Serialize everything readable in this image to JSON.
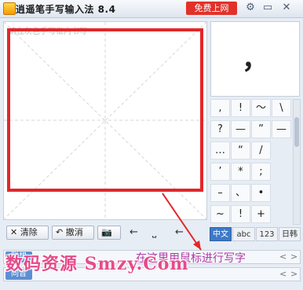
{
  "titlebar": {
    "title": "逍遥笔手写输入法 8.4",
    "promo_label": "免费上网",
    "settings_icon": "⚙",
    "minimize_icon": "▭",
    "close_icon": "✕"
  },
  "pad": {
    "hint": "请在灰色手写框内书写"
  },
  "preview": {
    "char": "，"
  },
  "symbols": [
    ",",
    "?",
    "…",
    "’",
    "–",
    "~",
    "!",
    "—",
    "“",
    "*",
    "、",
    "!",
    "～",
    "”",
    "/",
    ";",
    "•",
    "+",
    "\\",
    "—"
  ],
  "grid_tabs": [
    "中文",
    "abc",
    "123",
    "日韩"
  ],
  "toolbar": {
    "clear_label": "清除",
    "clear_icon": "✕",
    "undo_label": "撤消",
    "undo_icon": "↶",
    "camera_icon": "📷",
    "left_arrow": "←",
    "space_symbol": "⎵",
    "back_arrow": "←"
  },
  "rows": {
    "row1_label": "联想",
    "row2_label": "同音",
    "prev": "<",
    "next": ">"
  },
  "annotation": {
    "text": "在这里用鼠标进行写字"
  },
  "watermark": {
    "text": "数码资源 Smzy.Com"
  },
  "colors": {
    "accent_red": "#e2272a",
    "promo_red": "#e2312a",
    "annotation": "#b33aa6",
    "tab_active": "#3d79c6"
  }
}
